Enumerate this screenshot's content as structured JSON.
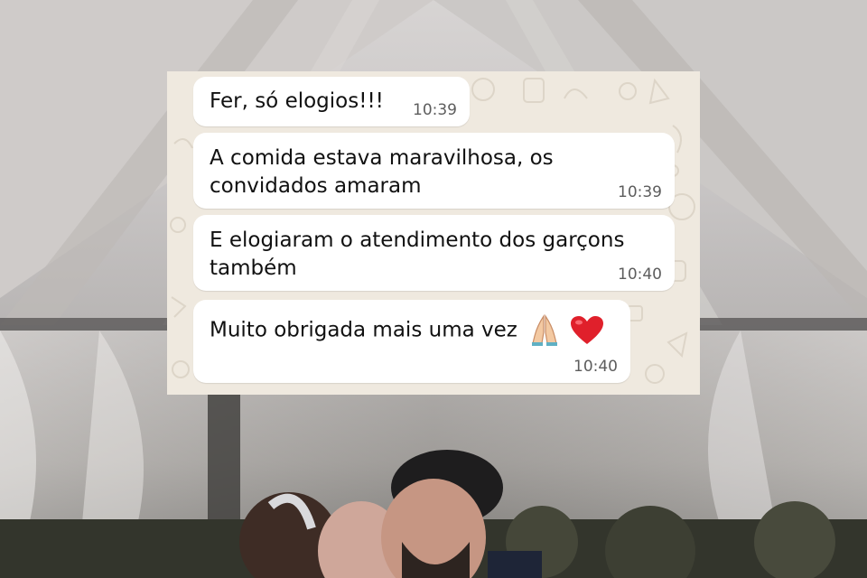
{
  "chat": {
    "messages": [
      {
        "text": "Fer, só elogios!!!",
        "time": "10:39"
      },
      {
        "line1": "A comida estava maravilhosa, os",
        "line2": "convidados amaram",
        "time": "10:39"
      },
      {
        "line1": "E elogiaram o atendimento dos garçons",
        "line2": "também",
        "time": "10:40"
      },
      {
        "text": "Muito obrigada mais uma vez",
        "emojis": [
          "folded-hands-icon",
          "red-heart-icon"
        ],
        "time": "10:40"
      }
    ]
  },
  "colors": {
    "chat_background": "#efe9df",
    "bubble": "#ffffff",
    "timestamp": "#5d5d5d",
    "heart": "#e0202b"
  }
}
